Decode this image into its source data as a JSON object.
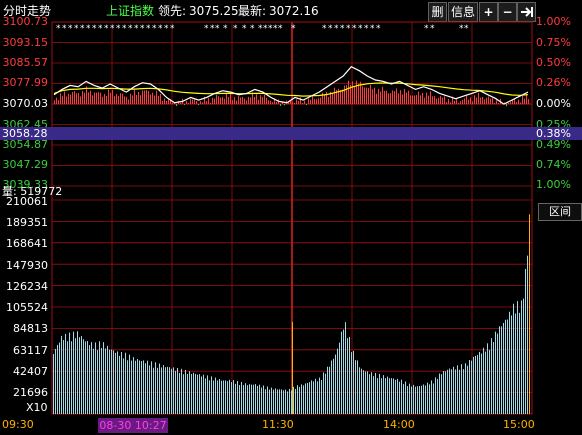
{
  "header": {
    "chart_label": "分时走势",
    "index_name": "上证指数",
    "lead_label": "领先:",
    "lead_value": "3075.25",
    "latest_label": "最新:",
    "latest_value": "3072.16",
    "btn_delete": "删",
    "btn_info": "信息",
    "btn_plus": "+",
    "btn_minus": "−",
    "btn_exit_icon": "exit-right-icon"
  },
  "colors": {
    "up": "#ff3b3b",
    "down": "#3ccf3c",
    "grid": "#a01010",
    "price_line": "#ffffff",
    "avg_line": "#ffff00",
    "volume_bar": "#9fdcea",
    "highlight_bg": "#3a2a88",
    "time_label": "#ffb000"
  },
  "price_axis": {
    "left": [
      "3100.73",
      "3093.15",
      "3085.57",
      "3077.99",
      "3070.03",
      "3062.45",
      "3054.87",
      "3047.29",
      "3039.33"
    ],
    "right": [
      "1.00%",
      "0.75%",
      "0.50%",
      "0.26%",
      "0.00%",
      "0.25%",
      "0.49%",
      "0.74%",
      "1.00%"
    ],
    "highlight_left": "3058.28",
    "highlight_right": "0.38%"
  },
  "volume_panel": {
    "label": "量: 519772",
    "button": "区间",
    "axis": [
      "210061",
      "189351",
      "168641",
      "147930",
      "126234",
      "105524",
      "84813",
      "63117",
      "42407",
      "21696"
    ],
    "multiplier": "X10"
  },
  "time_axis": {
    "start": "09:30",
    "date_cursor": "08-30 10:27",
    "t1130": "11:30",
    "t1400": "14:00",
    "t1500": "15:00"
  },
  "chart_data": {
    "type": "line",
    "title": "分时走势 上证指数",
    "x_range": [
      "09:30",
      "15:00"
    ],
    "ylim": [
      3039.33,
      3100.73
    ],
    "series": [
      {
        "values": [
          3073.5,
          3075.5,
          3077.0,
          3076.5,
          3078.5,
          3077.0,
          3076.0,
          3077.5,
          3076.0,
          3074.5,
          3076.5,
          3078.0,
          3077.5,
          3075.5,
          3072.5,
          3070.5,
          3071.0,
          3072.5,
          3071.5,
          3072.5,
          3074.0,
          3075.0,
          3074.5,
          3073.5,
          3074.0,
          3075.5,
          3074.5,
          3072.5,
          3071.0,
          3070.5,
          3072.5,
          3071.5,
          3073.0,
          3074.5,
          3076.5,
          3078.5,
          3080.5,
          3084.0,
          3082.5,
          3080.5,
          3079.0,
          3078.5,
          3077.5,
          3078.5,
          3077.0,
          3075.5,
          3076.5,
          3075.5,
          3074.0,
          3073.0,
          3072.0,
          3073.0,
          3074.0,
          3075.0,
          3073.5,
          3072.0,
          3070.0,
          3071.5,
          3073.0,
          3074.5
        ]
      },
      {
        "values": [
          3074.0,
          3075.0,
          3075.5,
          3075.6,
          3075.9,
          3075.9,
          3075.8,
          3075.9,
          3075.8,
          3075.6,
          3075.6,
          3075.8,
          3075.9,
          3075.7,
          3075.3,
          3074.8,
          3074.4,
          3074.2,
          3074.0,
          3073.9,
          3073.9,
          3074.0,
          3074.0,
          3073.9,
          3073.9,
          3074.0,
          3074.0,
          3073.8,
          3073.6,
          3073.3,
          3073.2,
          3073.0,
          3073.1,
          3073.2,
          3073.6,
          3074.3,
          3075.1,
          3076.3,
          3077.1,
          3077.6,
          3077.8,
          3077.9,
          3077.8,
          3077.8,
          3077.6,
          3077.3,
          3077.1,
          3076.8,
          3076.5,
          3076.1,
          3075.7,
          3075.4,
          3075.2,
          3075.1,
          3074.8,
          3074.4,
          3073.8,
          3073.4,
          3073.3,
          3073.5
        ]
      }
    ],
    "volume": [
      62,
      78,
      80,
      82,
      74,
      70,
      72,
      66,
      62,
      60,
      56,
      54,
      52,
      50,
      48,
      46,
      44,
      42,
      40,
      38,
      36,
      34,
      34,
      32,
      30,
      30,
      28,
      26,
      25,
      24,
      28,
      30,
      34,
      36,
      48,
      62,
      94,
      64,
      46,
      42,
      40,
      38,
      36,
      34,
      30,
      28,
      30,
      34,
      42,
      46,
      48,
      50,
      58,
      64,
      72,
      86,
      96,
      110,
      112,
      196
    ]
  }
}
